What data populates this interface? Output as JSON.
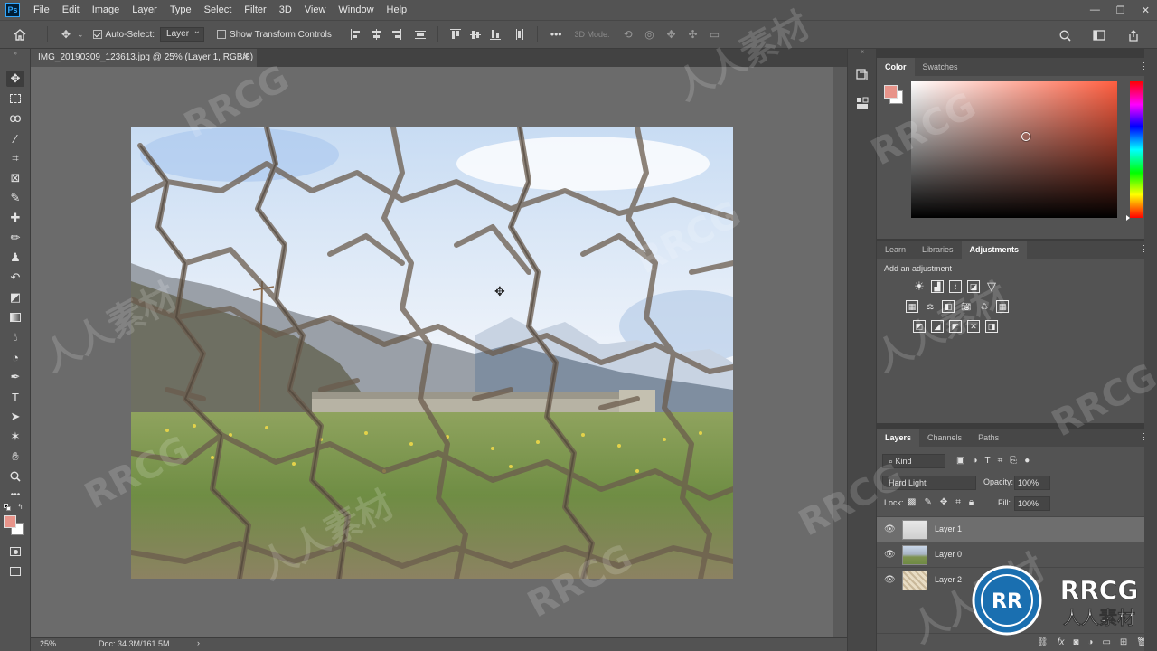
{
  "app": {
    "logo_text": "Ps",
    "menu": [
      "File",
      "Edit",
      "Image",
      "Layer",
      "Type",
      "Select",
      "Filter",
      "3D",
      "View",
      "Window",
      "Help"
    ],
    "window_controls": [
      "—",
      "❐",
      "✕"
    ]
  },
  "options": {
    "auto_select_label": "Auto-Select:",
    "auto_select_checked": true,
    "auto_select_value": "Layer",
    "transform_label": "Show Transform Controls",
    "transform_checked": false,
    "mode_3d_label": "3D Mode:"
  },
  "document": {
    "tab_title": "IMG_20190309_123613.jpg @ 25% (Layer 1, RGB/8) *",
    "close": "✕",
    "zoom": "25%",
    "doc_size": "Doc: 34.3M/161.5M",
    "status_arrow": "›"
  },
  "color_panel": {
    "tabs": [
      "Color",
      "Swatches"
    ],
    "active_tab": "Color",
    "foreground": "#e8948a",
    "background": "#ffffff"
  },
  "adjustments_panel": {
    "tabs": [
      "Learn",
      "Libraries",
      "Adjustments"
    ],
    "active_tab": "Adjustments",
    "title": "Add an adjustment",
    "rows": [
      [
        "brightness-contrast-icon",
        "levels-icon",
        "curves-icon",
        "exposure-icon",
        "vibrance-icon"
      ],
      [
        "hue-saturation-icon",
        "color-balance-icon",
        "black-white-icon",
        "photo-filter-icon",
        "channel-mixer-icon",
        "color-lookup-icon"
      ],
      [
        "invert-icon",
        "posterize-icon",
        "threshold-icon",
        "selective-color-icon",
        "gradient-map-icon"
      ]
    ]
  },
  "layers_panel": {
    "tabs": [
      "Layers",
      "Channels",
      "Paths"
    ],
    "active_tab": "Layers",
    "filter_label": "Kind",
    "blend_mode": "Hard Light",
    "opacity_label": "Opacity:",
    "opacity_value": "100%",
    "lock_label": "Lock:",
    "fill_label": "Fill:",
    "fill_value": "100%",
    "layers": [
      {
        "name": "Layer 1",
        "selected": true,
        "thumb": "cracks"
      },
      {
        "name": "Layer 0",
        "selected": false,
        "thumb": "landscape"
      },
      {
        "name": "Layer 2",
        "selected": false,
        "thumb": "texture"
      }
    ],
    "footer_icons": [
      "link-icon",
      "fx-icon",
      "mask-icon",
      "adjustment-layer-icon",
      "group-icon",
      "new-layer-icon",
      "trash-icon"
    ]
  },
  "watermark": {
    "text": "RRCG",
    "text_cn": "人人素材"
  }
}
